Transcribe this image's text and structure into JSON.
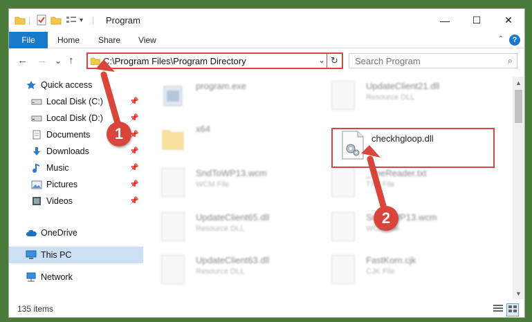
{
  "window": {
    "title": "Program",
    "minimize_label": "—",
    "maximize_label": "☐",
    "close_label": "✕"
  },
  "ribbon": {
    "file_tab": "File",
    "tabs": [
      "Home",
      "Share",
      "View"
    ],
    "help": "?",
    "collapse": "⌃"
  },
  "navbar": {
    "back": "←",
    "forward": "→",
    "recent": "⌄",
    "up": "↑",
    "address_path": "C:\\Program Files\\Program Directory",
    "address_dropdown": "⌄",
    "refresh": "↻",
    "search_placeholder": "Search Program",
    "search_icon": "⌕"
  },
  "sidebar": {
    "items": [
      {
        "label": "Quick access",
        "icon": "star-icon",
        "pinned": false
      },
      {
        "label": "Local Disk (C:)",
        "icon": "drive-icon",
        "pinned": true
      },
      {
        "label": "Local Disk (D:)",
        "icon": "drive-icon",
        "pinned": true
      },
      {
        "label": "Documents",
        "icon": "documents-icon",
        "pinned": true
      },
      {
        "label": "Downloads",
        "icon": "download-icon",
        "pinned": true
      },
      {
        "label": "Music",
        "icon": "music-icon",
        "pinned": true
      },
      {
        "label": "Pictures",
        "icon": "pictures-icon",
        "pinned": true
      },
      {
        "label": "Videos",
        "icon": "videos-icon",
        "pinned": true
      },
      {
        "label": "OneDrive",
        "icon": "cloud-icon",
        "pinned": false
      },
      {
        "label": "This PC",
        "icon": "computer-icon",
        "pinned": false,
        "selected": true
      },
      {
        "label": "Network",
        "icon": "network-icon",
        "pinned": false
      }
    ],
    "pin_glyph": "📌"
  },
  "files": [
    {
      "name": "program.exe",
      "type": ""
    },
    {
      "name": "UpdateClient21.dll",
      "type": "Resource DLL"
    },
    {
      "name": "x64",
      "type": ""
    },
    {
      "name": "checkhgloop.dll",
      "type": ""
    },
    {
      "name": "SndToWP13.wcm",
      "type": "WCM File"
    },
    {
      "name": "_fineReader.txt",
      "type": "TXT File"
    },
    {
      "name": "UpdateClient65.dll",
      "type": "Resource DLL"
    },
    {
      "name": "SndToWP13.wcm",
      "type": "WCM File"
    },
    {
      "name": "UpdateClient63.dll",
      "type": "Resource DLL"
    },
    {
      "name": "FastKorn.cjk",
      "type": "CJK File"
    }
  ],
  "status": {
    "item_count": "135 items"
  },
  "callouts": [
    "1",
    "2"
  ],
  "colors": {
    "accent": "#1979ca",
    "highlight": "#d9453a",
    "selected": "#cce0f5"
  }
}
